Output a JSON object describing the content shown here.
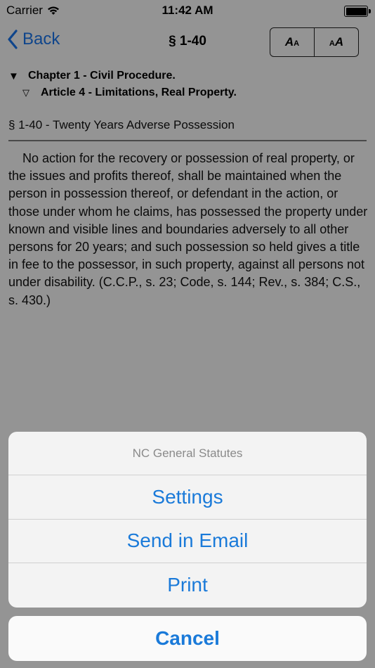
{
  "status_bar": {
    "carrier": "Carrier",
    "time": "11:42 AM"
  },
  "nav": {
    "back_label": "Back",
    "title": "§ 1-40",
    "font_smaller_label": "A",
    "font_larger_label": "A"
  },
  "tree": {
    "chapter": "Chapter 1 - Civil Procedure.",
    "article": "Article 4 - Limitations, Real Property.",
    "chapter_marker": "▼",
    "article_marker": "▽"
  },
  "section": {
    "heading": "§ 1-40 - Twenty Years Adverse Possession",
    "body": "No action for the recovery or possession of real property, or the issues and profits thereof, shall be maintained when the person in possession thereof, or defendant in the action, or those under whom he claims, has possessed the property under known and visible lines and boundaries adversely to all other persons for 20 years; and such possession so held gives a title in fee to the possessor, in such property, against all persons not under disability. (C.C.P., s. 23; Code, s. 144; Rev., s. 384; C.S., s. 430.)"
  },
  "action_sheet": {
    "title": "NC General Statutes",
    "items": [
      "Settings",
      "Send in Email",
      "Print"
    ],
    "cancel_label": "Cancel"
  },
  "colors": {
    "accent": "#1a7ad9",
    "overlay": "rgba(0,0,0,0.4)"
  }
}
